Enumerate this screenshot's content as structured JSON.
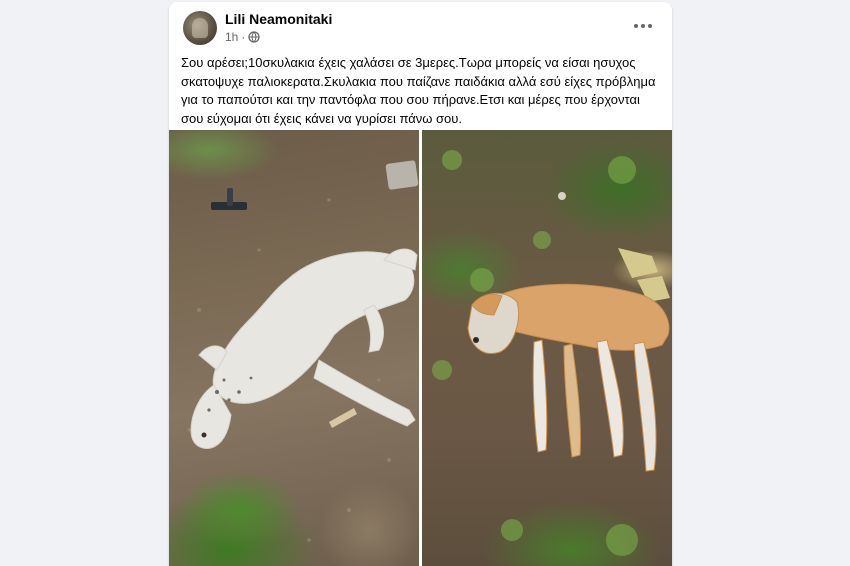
{
  "post": {
    "author": "Lili Neamonitaki",
    "time": "1h",
    "separator": "·",
    "privacy_icon": "globe-icon",
    "more_icon": "more-options-icon",
    "text": "Σου αρέσει;10σκυλακια έχεις χαλάσει σε 3μερες.Τωρα μπορείς να είσαι ησυχος σκατοψυχε παλιοκερατα.Σκυλακια που παίζανε παιδάκια αλλά εσύ είχες πρόβλημα για το παπούτσι και την παντόφλα που σου πήρανε.Ετσι και μέρες που έρχονται σου εύχομαι ότι έχεις κάνει να γυρίσει πάνω σου."
  },
  "photos": [
    {
      "subject": "white dog lying on dirt ground"
    },
    {
      "subject": "tan and white dog lying on dirt ground"
    }
  ],
  "colors": {
    "background": "#f0f2f5",
    "card": "#ffffff",
    "text_primary": "#050505",
    "text_secondary": "#65676b"
  }
}
